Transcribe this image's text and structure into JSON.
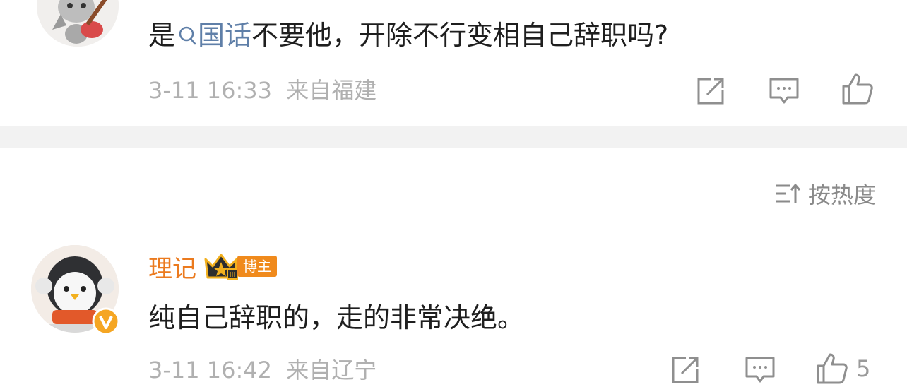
{
  "comments": [
    {
      "text_before": "是",
      "topic": "国话",
      "text_after": "不要他，开除不行变相自己辞职吗?",
      "time": "3-11 16:33",
      "location": "来自福建",
      "actions": [
        "share-icon",
        "comment-icon",
        "like-icon"
      ]
    },
    {
      "author": "理记",
      "badge_label": "博主",
      "text": "纯自己辞职的，走的非常决绝。",
      "time": "3-11 16:42",
      "location": "来自辽宁",
      "like_count": "5",
      "actions": [
        "share-icon",
        "comment-icon",
        "like-icon"
      ]
    }
  ],
  "sort": {
    "label": "按热度",
    "icon": "sort-icon"
  },
  "colors": {
    "accent_orange": "#eb7a1e",
    "link_blue": "#5f7fa8",
    "meta_gray": "#b0b0b0",
    "divider": "#f2f2f2"
  }
}
